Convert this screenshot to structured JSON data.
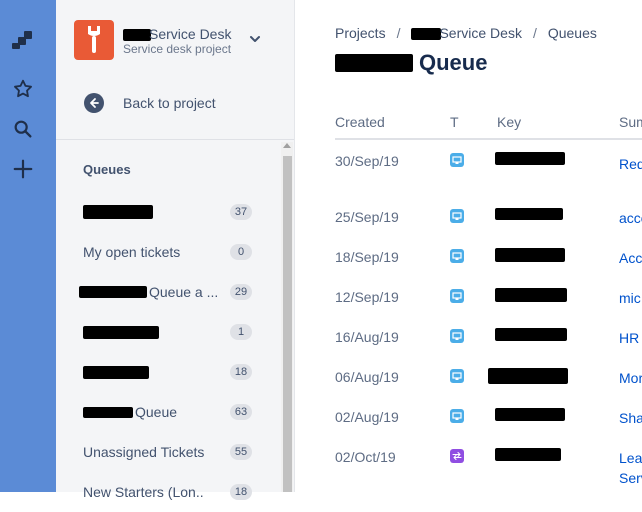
{
  "rail": {
    "icons": [
      "jira-logo-icon",
      "star-icon",
      "search-icon",
      "plus-icon"
    ]
  },
  "sidebar": {
    "project_name": "Service Desk",
    "project_type": "Service desk project",
    "back_label": "Back to project",
    "queues_heading": "Queues",
    "queues": [
      {
        "label": "",
        "count": "37",
        "redacted": true
      },
      {
        "label": "My open tickets",
        "count": "0",
        "redacted": false
      },
      {
        "label": "Queue a ...",
        "count": "29",
        "redacted": true
      },
      {
        "label": "",
        "count": "1",
        "redacted": true
      },
      {
        "label": "",
        "count": "18",
        "redacted": true
      },
      {
        "label": "Queue",
        "count": "63",
        "redacted": true
      },
      {
        "label": "Unassigned Tickets",
        "count": "55",
        "redacted": false
      },
      {
        "label": "New Starters (Lon...",
        "count": "18",
        "redacted": false
      }
    ]
  },
  "breadcrumb": {
    "projects": "Projects",
    "service_desk": "Service Desk",
    "queues": "Queues",
    "separator": "/"
  },
  "page": {
    "title": "Queue"
  },
  "table": {
    "headers": {
      "created": "Created",
      "type": "T",
      "key": "Key",
      "summary": "Sum"
    },
    "rows": [
      {
        "created": "30/Sep/19",
        "type": "service",
        "summary": "Req"
      },
      {
        "created": "25/Sep/19",
        "type": "service",
        "summary": "acce"
      },
      {
        "created": "18/Sep/19",
        "type": "service",
        "summary": "Acc"
      },
      {
        "created": "12/Sep/19",
        "type": "service",
        "summary": "mic"
      },
      {
        "created": "16/Aug/19",
        "type": "service",
        "summary": "HR"
      },
      {
        "created": "06/Aug/19",
        "type": "service",
        "summary": "Mor"
      },
      {
        "created": "02/Aug/19",
        "type": "service",
        "summary": "Sha"
      },
      {
        "created": "02/Oct/19",
        "type": "change",
        "summary": "Leav"
      }
    ],
    "extra_summary_line": "Serv"
  },
  "colors": {
    "rail": "#5b8bd6",
    "sidebar": "#F4F5F7",
    "project_avatar": "#e95a36",
    "link": "#0052CC",
    "service_type": "#4BADE8",
    "change_type": "#904EE2"
  }
}
